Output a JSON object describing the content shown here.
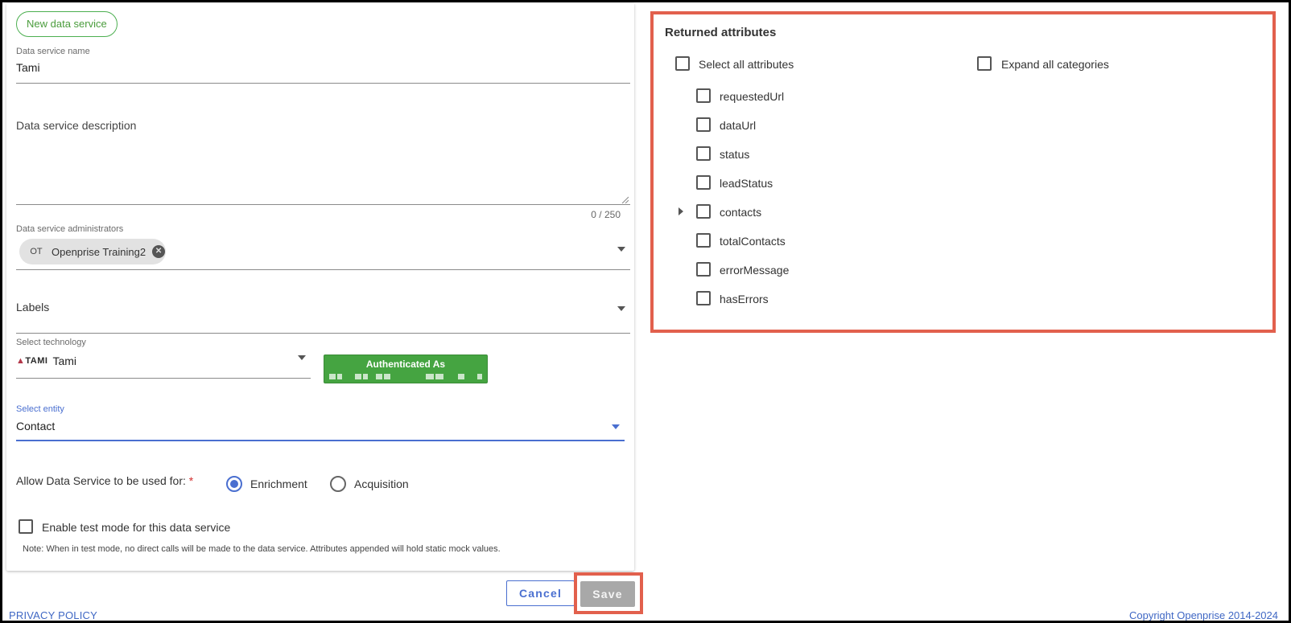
{
  "form": {
    "new_button": "New data service",
    "name": {
      "label": "Data service name",
      "value": "Tami"
    },
    "description": {
      "label": "Data service description",
      "counter": "0 / 250"
    },
    "administrators": {
      "label": "Data service administrators",
      "chip": {
        "avatar": "OT",
        "name": "Openprise Training2"
      }
    },
    "labels": {
      "label": "Labels"
    },
    "technology": {
      "label": "Select technology",
      "logo": "TAMI",
      "value": "Tami"
    },
    "auth": {
      "title": "Authenticated As"
    },
    "entity": {
      "label": "Select entity",
      "value": "Contact"
    },
    "usage": {
      "label": "Allow Data Service to be used for:",
      "required": "*",
      "options": [
        {
          "label": "Enrichment",
          "checked": true
        },
        {
          "label": "Acquisition",
          "checked": false
        }
      ]
    },
    "test_mode": {
      "label": "Enable test mode for this data service",
      "note": "Note: When in test mode, no direct calls will be made to the data service. Attributes appended will hold static mock values."
    }
  },
  "actions": {
    "cancel": "Cancel",
    "save": "Save"
  },
  "footer": {
    "privacy": "PRIVACY POLICY",
    "copyright": "Copyright Openprise 2014-2024"
  },
  "returned_attributes": {
    "title": "Returned attributes",
    "select_all": "Select all attributes",
    "expand_all": "Expand all categories",
    "items": [
      {
        "label": "requestedUrl",
        "expandable": false
      },
      {
        "label": "dataUrl",
        "expandable": false
      },
      {
        "label": "status",
        "expandable": false
      },
      {
        "label": "leadStatus",
        "expandable": false
      },
      {
        "label": "contacts",
        "expandable": true
      },
      {
        "label": "totalContacts",
        "expandable": false
      },
      {
        "label": "errorMessage",
        "expandable": false
      },
      {
        "label": "hasErrors",
        "expandable": false
      }
    ]
  },
  "colors": {
    "accent_blue": "#4a6fd0",
    "auth_green": "#45a441",
    "highlight_red": "#e2604d",
    "new_button_green": "#4caf50"
  }
}
